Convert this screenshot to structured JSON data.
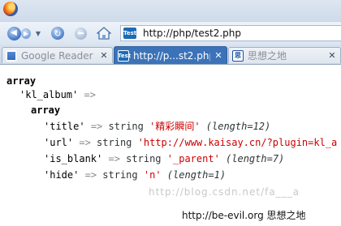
{
  "browser": {
    "url": "http://php/test2.php",
    "tabs": [
      {
        "label": "Google Reader",
        "active": false,
        "icon": "google-reader-favicon"
      },
      {
        "label": "http://p...st2.php",
        "active": true,
        "icon": "test-favicon"
      },
      {
        "label": "思想之地",
        "active": false,
        "icon": "sixiang-favicon"
      }
    ],
    "favicon_text": "Test"
  },
  "dump": {
    "array_keyword": "array",
    "outer_key": "'kl_album'",
    "arrow": "=>",
    "inner_array_keyword": "array",
    "entries": [
      {
        "key": "'title'",
        "type": "string",
        "value": "'精彩瞬间'",
        "length": "(length=12)"
      },
      {
        "key": "'url'",
        "type": "string",
        "value": "'http://www.kaisay.cn/?plugin=kl_a",
        "length": ""
      },
      {
        "key": "'is_blank'",
        "type": "string",
        "value": "'_parent'",
        "length": "(length=7)"
      },
      {
        "key": "'hide'",
        "type": "string",
        "value": "'n'",
        "length": "(length=1)"
      }
    ]
  },
  "watermark": "http://blog.csdn.net/fa___a",
  "footer_brand": "http://be-evil.org 思想之地",
  "colors": {
    "accent": "#3c73b8",
    "string": "#cc0000",
    "meta": "#2e3436"
  }
}
